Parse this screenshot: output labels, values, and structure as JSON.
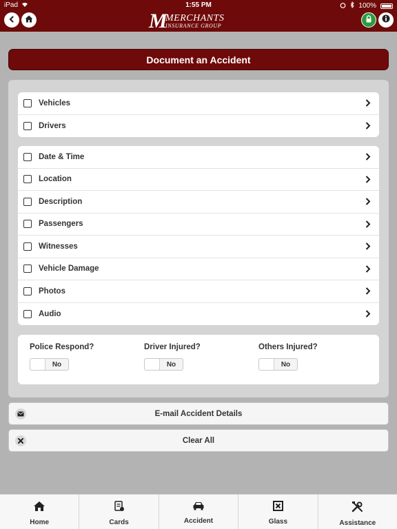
{
  "status_bar": {
    "device": "iPad",
    "time": "1:55 PM",
    "battery": "100%"
  },
  "header": {
    "logo_big_letter": "M",
    "logo_text": "MERCHANTS",
    "logo_subtext": "INSURANCE GROUP"
  },
  "page": {
    "title": "Document an Accident"
  },
  "groups": [
    {
      "items": [
        {
          "label": "Vehicles"
        },
        {
          "label": "Drivers"
        }
      ]
    },
    {
      "items": [
        {
          "label": "Date & Time"
        },
        {
          "label": "Location"
        },
        {
          "label": "Description"
        },
        {
          "label": "Passengers"
        },
        {
          "label": "Witnesses"
        },
        {
          "label": "Vehicle Damage"
        },
        {
          "label": "Photos"
        },
        {
          "label": "Audio"
        }
      ]
    }
  ],
  "questions": [
    {
      "label": "Police Respond?",
      "value": "No"
    },
    {
      "label": "Driver Injured?",
      "value": "No"
    },
    {
      "label": "Others Injured?",
      "value": "No"
    }
  ],
  "actions": {
    "email": "E-mail Accident Details",
    "clear": "Clear All"
  },
  "tabs": [
    {
      "label": "Home",
      "icon": "home-icon"
    },
    {
      "label": "Cards",
      "icon": "cards-icon"
    },
    {
      "label": "Accident",
      "icon": "car-icon"
    },
    {
      "label": "Glass",
      "icon": "glass-icon"
    },
    {
      "label": "Assistance",
      "icon": "tools-icon"
    }
  ],
  "colors": {
    "brand": "#6f0a0a",
    "lock_green": "#2e9a3f",
    "background": "#b3b3b3"
  }
}
